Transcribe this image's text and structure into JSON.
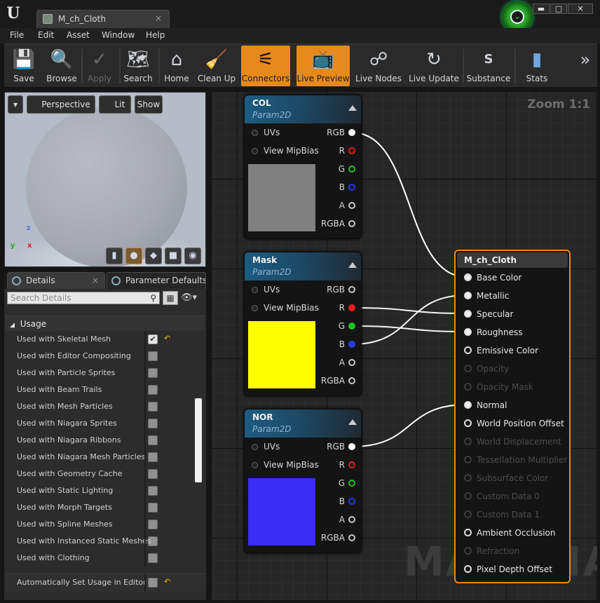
{
  "window": {
    "tab_title": "M_ch_Cloth",
    "tab_close": "×",
    "logo": "U",
    "controls": {
      "minimize": "▬",
      "maximize": "□",
      "close": "✕"
    },
    "notification": "⌄"
  },
  "menu": [
    "File",
    "Edit",
    "Asset",
    "Window",
    "Help"
  ],
  "toolbar": [
    {
      "label": "Save",
      "icon": "💾"
    },
    {
      "label": "Browse",
      "icon": "🔍"
    },
    {
      "label": "Apply",
      "icon": "✓"
    },
    {
      "label": "Search",
      "icon": "🗺"
    },
    {
      "label": "Home",
      "icon": "⌂"
    },
    {
      "label": "Clean Up",
      "icon": "🧹"
    },
    {
      "label": "Connectors",
      "icon": "⚟"
    },
    {
      "label": "Live Preview",
      "icon": "📺"
    },
    {
      "label": "Live Nodes",
      "icon": "☍"
    },
    {
      "label": "Live Update",
      "icon": "↻"
    },
    {
      "label": "Substance",
      "icon": "S"
    },
    {
      "label": "Stats",
      "icon": "▮"
    },
    {
      "label": "",
      "icon": "»"
    }
  ],
  "viewport": {
    "dropdown_icon": "▾",
    "perspective": "Perspective",
    "lit": "Lit",
    "show": "Show",
    "axis_z": "z",
    "axis_y": "y",
    "axis_x": "x",
    "shapes": [
      "▮",
      "●",
      "◆",
      "■",
      "◉"
    ]
  },
  "details_tabs": {
    "details": "Details",
    "details_close": "×",
    "parameters": "Parameter Defaults"
  },
  "details": {
    "search_placeholder": "Search Details",
    "search_icon": "⚲",
    "grid_icon": "▦",
    "eye_icon": "👁▾",
    "section": "Usage",
    "section_arrow": "◢",
    "rows": [
      {
        "label": "Used with Skeletal Mesh",
        "checked": true
      },
      {
        "label": "Used with Editor Compositing",
        "checked": false
      },
      {
        "label": "Used with Particle Sprites",
        "checked": false
      },
      {
        "label": "Used with Beam Trails",
        "checked": false
      },
      {
        "label": "Used with Mesh Particles",
        "checked": false
      },
      {
        "label": "Used with Niagara Sprites",
        "checked": false
      },
      {
        "label": "Used with Niagara Ribbons",
        "checked": false
      },
      {
        "label": "Used with Niagara Mesh Particles",
        "checked": false
      },
      {
        "label": "Used with Geometry Cache",
        "checked": false
      },
      {
        "label": "Used with Static Lighting",
        "checked": false
      },
      {
        "label": "Used with Morph Targets",
        "checked": false
      },
      {
        "label": "Used with Spline Meshes",
        "checked": false
      },
      {
        "label": "Used with Instanced Static Meshes",
        "checked": false
      },
      {
        "label": "Used with Clothing",
        "checked": false
      }
    ],
    "auto_usage": {
      "label": "Automatically Set Usage in Editor",
      "checked": false
    },
    "check_glyph": "✔",
    "reset_glyph": "↶"
  },
  "graph": {
    "zoom": "Zoom 1:1",
    "watermark": "MATERIAL",
    "nodes": [
      {
        "title": "COL",
        "subtitle": "Param2D",
        "swatch": "#808080",
        "inputs": [
          "UVs",
          "View MipBias"
        ],
        "outputs": [
          {
            "label": "RGB",
            "color": "#ffffff",
            "connected": true
          },
          {
            "label": "R",
            "color": "#e02020",
            "connected": false
          },
          {
            "label": "G",
            "color": "#20c020",
            "connected": false
          },
          {
            "label": "B",
            "color": "#2040e0",
            "connected": false
          },
          {
            "label": "A",
            "color": "#c8c8c8",
            "connected": false
          },
          {
            "label": "RGBA",
            "color": "#c8c8c8",
            "connected": false
          }
        ]
      },
      {
        "title": "Mask",
        "subtitle": "Param2D",
        "swatch": "#ffff00",
        "inputs": [
          "UVs",
          "View MipBias"
        ],
        "outputs": [
          {
            "label": "RGB",
            "color": "#c8c8c8",
            "connected": false
          },
          {
            "label": "R",
            "color": "#e02020",
            "connected": true
          },
          {
            "label": "G",
            "color": "#20c020",
            "connected": true
          },
          {
            "label": "B",
            "color": "#2040e0",
            "connected": true
          },
          {
            "label": "A",
            "color": "#c8c8c8",
            "connected": false
          },
          {
            "label": "RGBA",
            "color": "#c8c8c8",
            "connected": false
          }
        ]
      },
      {
        "title": "NOR",
        "subtitle": "Param2D",
        "swatch": "#3a2cf5",
        "inputs": [
          "UVs",
          "View MipBias"
        ],
        "outputs": [
          {
            "label": "RGB",
            "color": "#ffffff",
            "connected": true
          },
          {
            "label": "R",
            "color": "#e02020",
            "connected": false
          },
          {
            "label": "G",
            "color": "#20c020",
            "connected": false
          },
          {
            "label": "B",
            "color": "#2040e0",
            "connected": false
          },
          {
            "label": "A",
            "color": "#c8c8c8",
            "connected": false
          },
          {
            "label": "RGBA",
            "color": "#c8c8c8",
            "connected": false
          }
        ]
      }
    ],
    "material": {
      "title": "M_ch_Cloth",
      "pins": [
        {
          "label": "Base Color",
          "enabled": true,
          "connected": true
        },
        {
          "label": "Metallic",
          "enabled": true,
          "connected": true
        },
        {
          "label": "Specular",
          "enabled": true,
          "connected": true
        },
        {
          "label": "Roughness",
          "enabled": true,
          "connected": true
        },
        {
          "label": "Emissive Color",
          "enabled": true,
          "connected": false
        },
        {
          "label": "Opacity",
          "enabled": false,
          "connected": false
        },
        {
          "label": "Opacity Mask",
          "enabled": false,
          "connected": false
        },
        {
          "label": "Normal",
          "enabled": true,
          "connected": true
        },
        {
          "label": "World Position Offset",
          "enabled": true,
          "connected": false
        },
        {
          "label": "World Displacement",
          "enabled": false,
          "connected": false
        },
        {
          "label": "Tessellation Multiplier",
          "enabled": false,
          "connected": false
        },
        {
          "label": "Subsurface Color",
          "enabled": false,
          "connected": false
        },
        {
          "label": "Custom Data 0",
          "enabled": false,
          "connected": false
        },
        {
          "label": "Custom Data 1",
          "enabled": false,
          "connected": false
        },
        {
          "label": "Ambient Occlusion",
          "enabled": true,
          "connected": false
        },
        {
          "label": "Refraction",
          "enabled": false,
          "connected": false
        },
        {
          "label": "Pixel Depth Offset",
          "enabled": true,
          "connected": false
        }
      ]
    }
  },
  "colors": {
    "accent": "#e8891c",
    "graph_bg": "#262626",
    "node_header": "#1d5c82"
  }
}
